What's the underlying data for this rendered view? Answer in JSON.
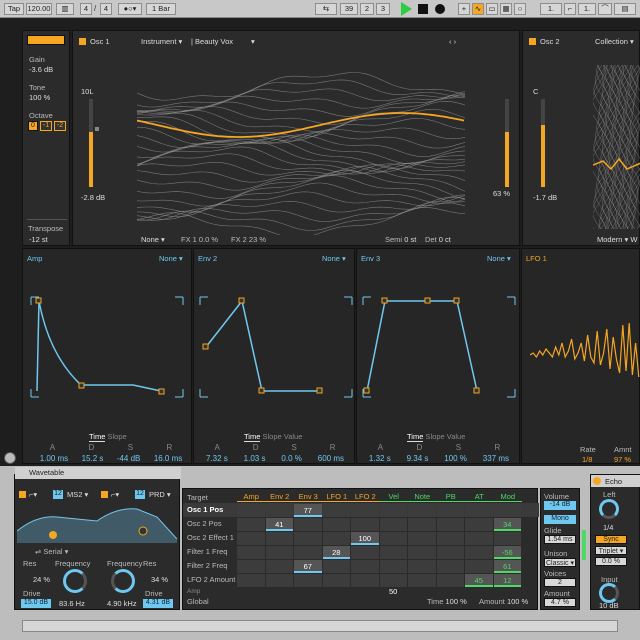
{
  "transport": {
    "tap": "Tap",
    "tempo": "120.00",
    "sig_num": "4",
    "sig_den": "4",
    "quant": "1 Bar",
    "pos1": "39",
    "pos2": "2",
    "pos3": "3"
  },
  "left": {
    "gain_label": "Gain",
    "gain_value": "-3.6 dB",
    "tone_label": "Tone",
    "tone_value": "100 %",
    "octave_label": "Octave",
    "oct_buttons": [
      "0",
      "-1",
      "-2"
    ],
    "transpose_label": "Transpose",
    "transpose_value": "-12 st"
  },
  "osc1": {
    "title": "Osc 1",
    "category": "Instrument",
    "wavetable": "Beauty Vox",
    "level_label": "10L",
    "level_db": "-2.8 dB",
    "pos_pct": "63 %",
    "fx_mode": "None",
    "fx1": "FX 1 0.0 %",
    "fx2": "FX 2 23 %",
    "semi_label": "Semi",
    "semi_value": "0 st",
    "det_label": "Det",
    "det_value": "0 ct",
    "level_fraction": 0.62,
    "pos_fraction": 0.63
  },
  "osc2": {
    "title": "Osc 2",
    "category": "Collection",
    "level_label": "C",
    "level_db": "-1.7 dB",
    "fx_mode": "Modern",
    "fx_extra": "W"
  },
  "envs": [
    {
      "title": "Amp",
      "mode": "None",
      "tabs": [
        "Time",
        "Slope"
      ],
      "labels": [
        "A",
        "D",
        "S",
        "R"
      ],
      "values": [
        "1.00 ms",
        "15.2 s",
        "-44 dB",
        "16.0 ms"
      ]
    },
    {
      "title": "Env 2",
      "mode": "None",
      "tabs": [
        "Time",
        "Slope",
        "Value"
      ],
      "labels": [
        "A",
        "D",
        "S",
        "R"
      ],
      "values": [
        "7.32 s",
        "1.03 s",
        "0.0 %",
        "600 ms"
      ]
    },
    {
      "title": "Env 3",
      "mode": "None",
      "tabs": [
        "Time",
        "Slope",
        "Value"
      ],
      "labels": [
        "A",
        "D",
        "S",
        "R"
      ],
      "values": [
        "1.32 s",
        "9.34 s",
        "100 %",
        "337 ms"
      ]
    }
  ],
  "lfo1": {
    "title": "LFO 1",
    "rate_label": "Rate",
    "rate_value": "1/8",
    "amount_label": "Amnt",
    "amount_value": "97 %"
  },
  "wavetable_device": {
    "title": "Wavetable",
    "filter1_num": "12",
    "filter1_type": "MS2",
    "filter2_num": "12",
    "filter2_type": "PRD",
    "routing": "Serial",
    "f1": {
      "res_label": "Res",
      "res_value": "24 %",
      "freq_label": "Frequency",
      "freq_value": "83.6 Hz",
      "drive_label": "Drive",
      "drive_value": "15.0 dB"
    },
    "f2": {
      "freq_label": "Frequency",
      "freq_value": "4.90 kHz",
      "res_label": "Res",
      "res_value": "34 %",
      "drive_label": "Drive",
      "drive_value": "4.31 dB"
    }
  },
  "matrix": {
    "target_label": "Target",
    "sources": [
      "Amp",
      "Env 2",
      "Env 3",
      "LFO 1",
      "LFO 2",
      "Vel",
      "Note",
      "PB",
      "AT",
      "Mod"
    ],
    "rows": [
      {
        "name": "Osc 1 Pos",
        "cells": [
          "",
          "",
          "77",
          "",
          "",
          "",
          "",
          "",
          "",
          ""
        ]
      },
      {
        "name": "Osc 2 Pos",
        "cells": [
          "",
          "41",
          "",
          "",
          "",
          "",
          "",
          "",
          "",
          "34"
        ]
      },
      {
        "name": "Osc 2 Effect 1",
        "cells": [
          "",
          "",
          "",
          "",
          "100",
          "",
          "",
          "",
          "",
          ""
        ]
      },
      {
        "name": "Filter 1 Freq",
        "cells": [
          "",
          "",
          "",
          "28",
          "",
          "",
          "",
          "",
          "",
          "-56"
        ]
      },
      {
        "name": "Filter 2 Freq",
        "cells": [
          "",
          "",
          "67",
          "",
          "",
          "",
          "",
          "",
          "",
          "61"
        ]
      },
      {
        "name": "LFO 2 Amount",
        "cells": [
          "",
          "",
          "",
          "",
          "",
          "",
          "",
          "",
          "45",
          "12"
        ]
      }
    ],
    "extra_row_label": "Amp",
    "extra_value": "50",
    "global_label": "Global",
    "time_label": "Time",
    "time_value": "100 %",
    "amount_label": "Amount",
    "amount_value": "100 %"
  },
  "voice": {
    "volume_label": "Volume",
    "volume_value": "-14 dB",
    "mode_button": "Mono",
    "glide_label": "Glide",
    "glide_value": "1.54 ms",
    "unison_label": "Unison",
    "unison_value": "Classic",
    "voices_label": "Voices",
    "voices_value": "2",
    "amount_label": "Amount",
    "amount_value": "4.7 %"
  },
  "echo": {
    "title": "Echo",
    "left_label": "Left",
    "left_value": "1/4",
    "sync_button": "Sync",
    "sync_mode": "Triplet",
    "pct": "0.0 %",
    "input_label": "Input",
    "input_value": "10 dB"
  },
  "colors": {
    "accent": "#f5a623",
    "blue": "#6fc8ef",
    "green": "#4cd964"
  }
}
